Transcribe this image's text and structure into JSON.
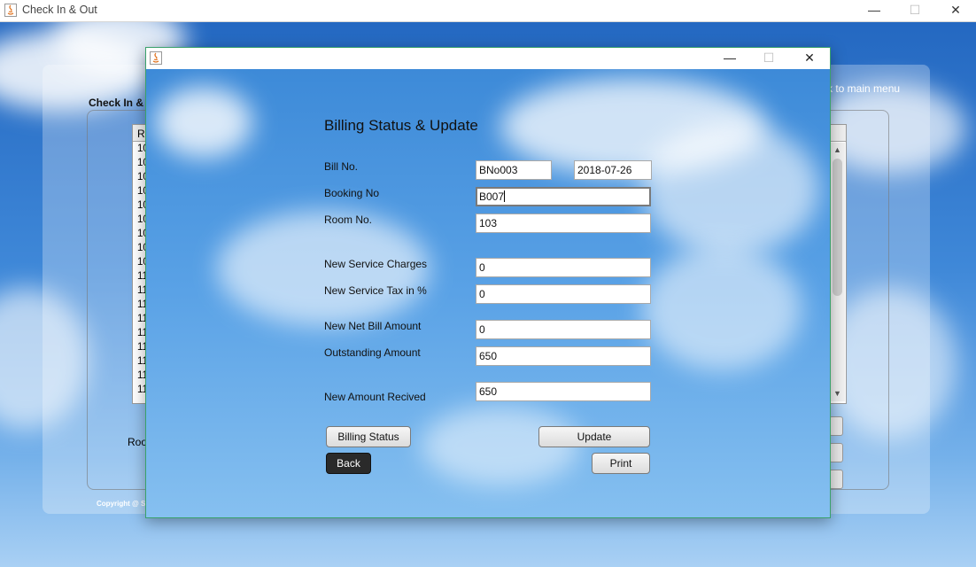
{
  "window": {
    "title": "Check In & Out",
    "controls": {
      "minimize": "—",
      "maximize": "☐",
      "close": "✕"
    }
  },
  "background": {
    "frame_title": "Check In &",
    "back_link": "ck to main menu",
    "table_header": "R",
    "table_rows": [
      "10",
      "10",
      "10",
      "10",
      "10",
      "10",
      "10",
      "10",
      "10",
      "11",
      "11",
      "11",
      "11",
      "11",
      "11",
      "11",
      "11",
      "11"
    ],
    "room_label": "Roo",
    "copyright": "Copyright @ Si"
  },
  "dialog": {
    "controls": {
      "minimize": "—",
      "maximize": "☐",
      "close": "✕"
    },
    "heading": "Billing Status & Update",
    "fields": {
      "bill_no": {
        "label": "Bill No.",
        "value": "BNo003",
        "date": "2018-07-26"
      },
      "booking_no": {
        "label": "Booking No",
        "value": "B007"
      },
      "room_no": {
        "label": "Room No.",
        "value": "103"
      },
      "new_service_charges": {
        "label": "New Service Charges",
        "value": "0"
      },
      "new_service_tax": {
        "label": "New Service Tax in %",
        "value": "0"
      },
      "new_net_bill": {
        "label": "New Net Bill Amount",
        "value": "0"
      },
      "outstanding": {
        "label": "Outstanding Amount",
        "value": "650"
      },
      "new_amount_received": {
        "label": "New Amount Recived",
        "value": "650"
      }
    },
    "buttons": {
      "billing_status": "Billing Status",
      "update": "Update",
      "back": "Back",
      "print": "Print"
    }
  }
}
